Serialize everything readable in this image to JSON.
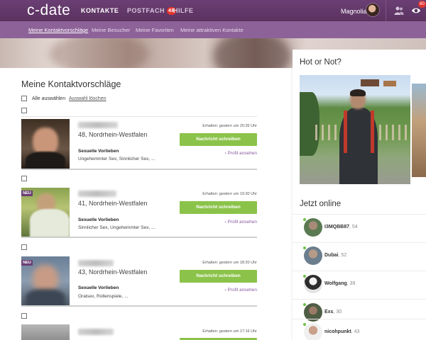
{
  "header": {
    "logo": "c-date",
    "nav": [
      {
        "label": "KONTAKTE",
        "active": true
      },
      {
        "label": "POSTFACH",
        "badge": "48",
        "active": false
      },
      {
        "label": "HILFE",
        "active": false
      }
    ],
    "user_name": "Magnolia",
    "eye_badge": "60"
  },
  "subnav": [
    {
      "label": "Meine Kontaktvorschläge",
      "active": true
    },
    {
      "label": "Meine Besucher",
      "active": false
    },
    {
      "label": "Meine Favoriten",
      "active": false
    },
    {
      "label": "Meine attraktiven Kontakte",
      "active": false
    }
  ],
  "main": {
    "title": "Meine Kontaktvorschläge",
    "select_all": "Alle auswählen",
    "clear_selection": "Auswahl löschen",
    "cards": [
      {
        "is_new": false,
        "age_location": "48, Nordrhein-Westfalen",
        "prefs_label": "Sexuelle Vorlieben",
        "prefs_value": "Ungehemmter Sex, Sinnlicher Sex, ...",
        "received": "Erhalten: gestern um 20:35 Uhr",
        "message_button": "Nachricht schreiben",
        "profile_link": "› Profil ansehen"
      },
      {
        "is_new": true,
        "new_label": "NEU",
        "age_location": "41, Nordrhein-Westfalen",
        "prefs_label": "Sexuelle Vorlieben",
        "prefs_value": "Sinnlicher Sex, Ungehemmter Sex, ...",
        "received": "Erhalten: gestern um 19:30 Uhr",
        "message_button": "Nachricht schreiben",
        "profile_link": "› Profil ansehen"
      },
      {
        "is_new": true,
        "new_label": "NEU",
        "age_location": "43, Nordrhein-Westfalen",
        "prefs_label": "Sexuelle Vorlieben",
        "prefs_value": "Oralsex, Rollenspiele, ...",
        "received": "Erhalten: gestern um 18:20 Uhr",
        "message_button": "Nachricht schreiben",
        "profile_link": "› Profil ansehen"
      },
      {
        "is_new": false,
        "received": "Erhalten: gestern um 17:16 Uhr"
      }
    ]
  },
  "sidebar": {
    "hot_title": "Hot or Not?",
    "online_title": "Jetzt online",
    "online": [
      {
        "name": "I3MQBB87",
        "age": ", 54"
      },
      {
        "name": "Dubai",
        "age": ", 52"
      },
      {
        "name": "Wolfgang",
        "age": ", 39"
      },
      {
        "name": "Exs",
        "age": ", 30"
      },
      {
        "name": "nicohpunkt",
        "age": ", 43"
      }
    ]
  },
  "colors": {
    "brand_purple": "#6b3f74",
    "subnav_purple": "#8d6298",
    "button_green": "#8bc34a",
    "badge_red": "#e3342f",
    "online_green": "#6cc04a"
  }
}
